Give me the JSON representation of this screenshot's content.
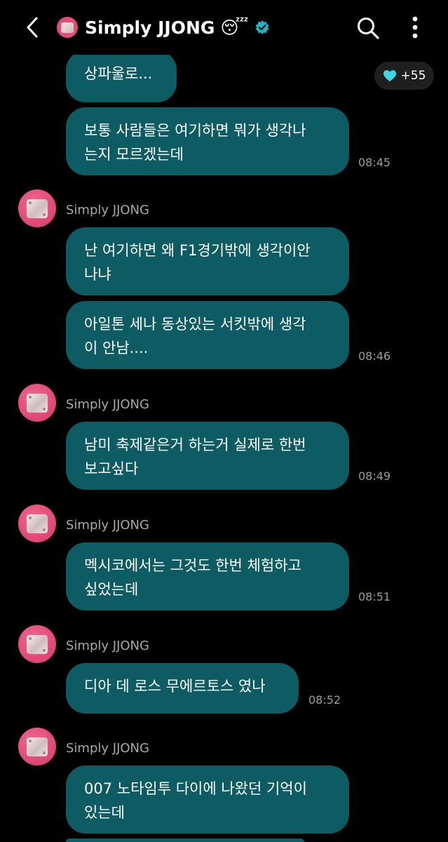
{
  "header": {
    "title": "Simply JJONG",
    "title_emoji": "😴",
    "verified_icon": "verified-badge-icon",
    "accent_color": "#20b4c6"
  },
  "reaction": {
    "icon": "heart-icon",
    "count": "+55",
    "color": "#3fd6e3"
  },
  "colors": {
    "bubble": "#0d5c63",
    "background": "#000000",
    "avatar": "#e44a7c"
  },
  "messages": [
    {
      "text": "상파울로...",
      "time": ""
    },
    {
      "text": "보통 사람들은 여기하면 뭐가 생각나\n는지 모르겠는데",
      "time": "08:45"
    },
    {
      "sender": "Simply JJONG"
    },
    {
      "text": "난 여기하면 왜 F1경기밖에 생각이안\n나냐",
      "time": ""
    },
    {
      "text": "아일톤 세나 동상있는 서킷밖에 생각\n이 안남....",
      "time": "08:46"
    },
    {
      "sender": "Simply JJONG"
    },
    {
      "text": "남미 축제같은거 하는거 실제로 한번\n보고싶다",
      "time": "08:49"
    },
    {
      "sender": "Simply JJONG"
    },
    {
      "text": "멕시코에서는 그것도 한번 체험하고\n싶었는데",
      "time": "08:51"
    },
    {
      "sender": "Simply JJONG"
    },
    {
      "text": "디아 데 로스 무에르토스 였나",
      "time": "08:52"
    },
    {
      "sender": "Simply JJONG"
    },
    {
      "text": "007 노타임투 다이에 나왔던 기억이\n있는데",
      "time": ""
    }
  ]
}
